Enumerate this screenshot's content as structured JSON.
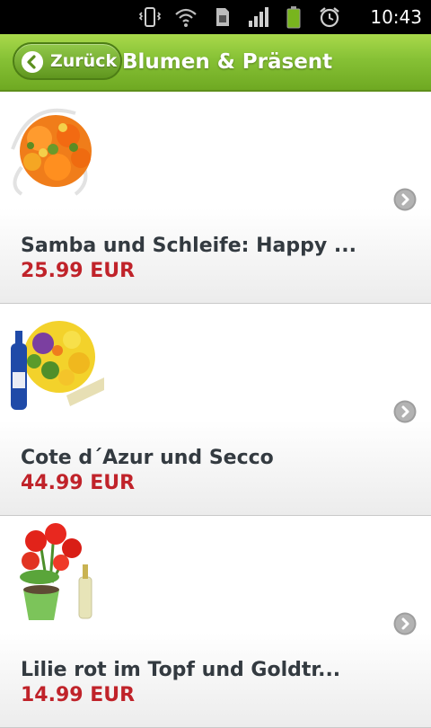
{
  "status_bar": {
    "time": "10:43",
    "icons": [
      "vibrate-icon",
      "wifi-icon",
      "sim-icon",
      "signal-icon",
      "battery-icon",
      "alarm-icon"
    ]
  },
  "header": {
    "back_label": "Zurück",
    "title": "Blumen & Präsent"
  },
  "products": [
    {
      "name": "Samba und Schleife: Happy ...",
      "price": "25.99 EUR"
    },
    {
      "name": "Cote d´Azur und Secco",
      "price": "44.99 EUR"
    },
    {
      "name": "Lilie rot im Topf und Goldtr...",
      "price": "14.99 EUR"
    }
  ],
  "colors": {
    "header_green": "#86c135",
    "price_red": "#c0232a",
    "name_text": "#333a40"
  }
}
